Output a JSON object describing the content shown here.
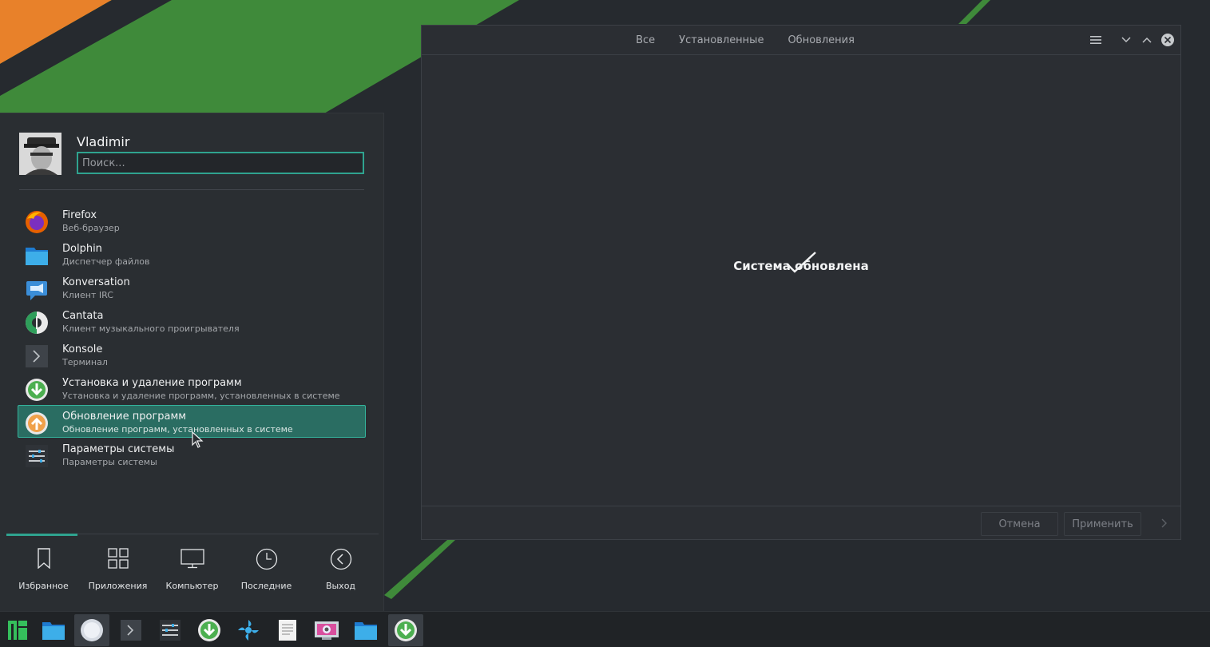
{
  "window": {
    "tabs": [
      "Все",
      "Установленные",
      "Обновления"
    ],
    "status_text": "Система обновлена",
    "cancel_label": "Отмена",
    "apply_label": "Применить"
  },
  "menu": {
    "username": "Vladimir",
    "search_placeholder": "Поиск...",
    "apps": [
      {
        "name": "Firefox",
        "desc": "Веб-браузер",
        "icon": "firefox-icon"
      },
      {
        "name": "Dolphin",
        "desc": "Диспетчер файлов",
        "icon": "folder-icon"
      },
      {
        "name": "Konversation",
        "desc": "Клиент IRC",
        "icon": "chat-icon"
      },
      {
        "name": "Cantata",
        "desc": "Клиент музыкального проигрывателя",
        "icon": "music-player-icon"
      },
      {
        "name": "Konsole",
        "desc": "Терминал",
        "icon": "terminal-icon"
      },
      {
        "name": "Установка и удаление программ",
        "desc": "Установка и удаление программ, установленных в системе",
        "icon": "install-icon"
      },
      {
        "name": "Обновление программ",
        "desc": "Обновление программ, установленных в системе",
        "icon": "update-icon"
      },
      {
        "name": "Параметры системы",
        "desc": "Параметры системы",
        "icon": "settings-icon"
      }
    ],
    "nav": [
      {
        "label": "Избранное",
        "icon": "bookmark-icon"
      },
      {
        "label": "Приложения",
        "icon": "grid-icon"
      },
      {
        "label": "Компьютер",
        "icon": "monitor-icon"
      },
      {
        "label": "Последние",
        "icon": "clock-icon"
      },
      {
        "label": "Выход",
        "icon": "back-icon"
      }
    ]
  },
  "colors": {
    "accent": "#2fa38f",
    "wallpaper_green": "#3f8a3a",
    "wallpaper_orange": "#e8812a"
  }
}
